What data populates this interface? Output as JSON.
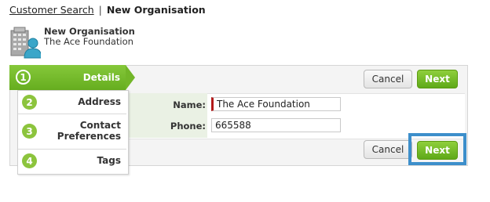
{
  "breadcrumb": {
    "link_label": "Customer Search",
    "separator": "|",
    "current": "New Organisation"
  },
  "header": {
    "title": "New Organisation",
    "org_name": "The Ace Foundation",
    "icon": "organisation-building-icon"
  },
  "steps": [
    {
      "number": "1",
      "label": "Details",
      "active": true
    },
    {
      "number": "2",
      "label": "Address",
      "active": false
    },
    {
      "number": "3",
      "label_line1": "Contact",
      "label_line2": "Preferences",
      "active": false
    },
    {
      "number": "4",
      "label": "Tags",
      "active": false
    }
  ],
  "form": {
    "name_label": "Name:",
    "name_value": "The Ace Foundation",
    "phone_label": "Phone:",
    "phone_value": "665588"
  },
  "buttons": {
    "cancel": "Cancel",
    "next": "Next"
  },
  "colors": {
    "accent_green": "#6cb124",
    "highlight_blue": "#3d8fcb",
    "required_red": "#b31b1b"
  }
}
